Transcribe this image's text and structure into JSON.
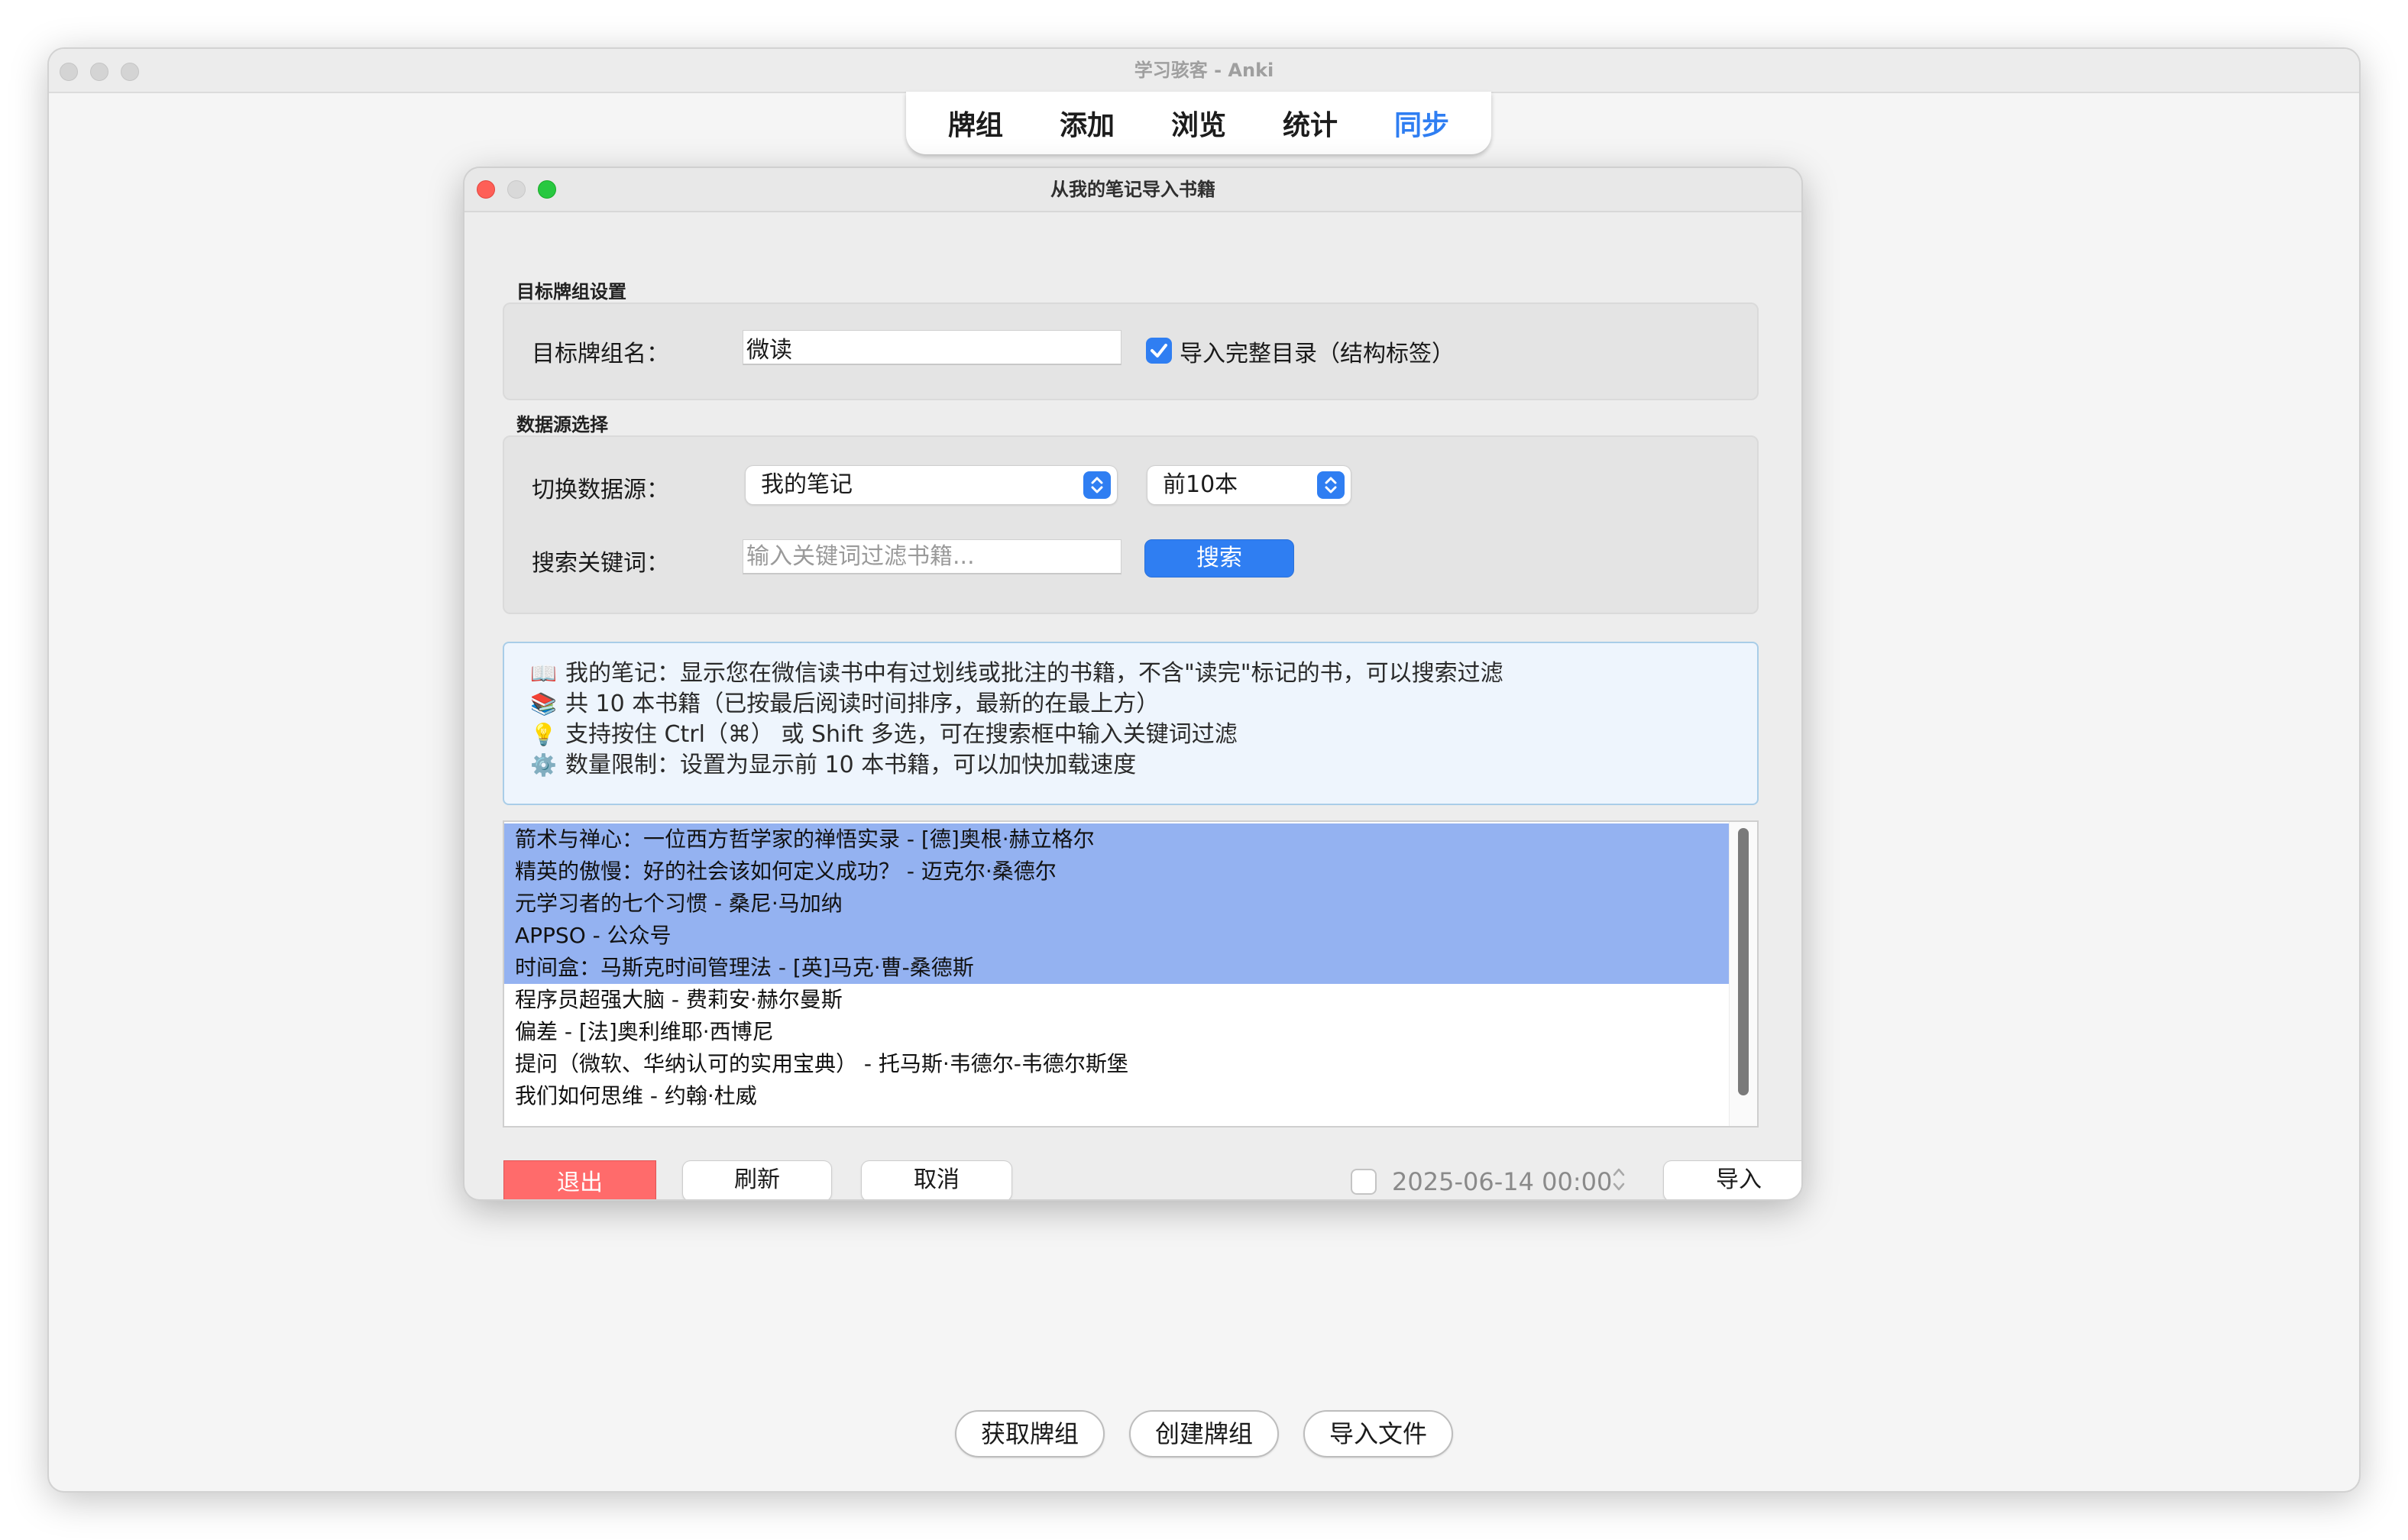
{
  "window": {
    "title": "学习骇客 - Anki"
  },
  "toolbar": {
    "items": [
      {
        "label": "牌组",
        "active": false
      },
      {
        "label": "添加",
        "active": false
      },
      {
        "label": "浏览",
        "active": false
      },
      {
        "label": "统计",
        "active": false
      },
      {
        "label": "同步",
        "active": true
      }
    ],
    "active_color": "#2f7ef2"
  },
  "bottom_buttons": {
    "get_decks": "获取牌组",
    "create_deck": "创建牌组",
    "import_file": "导入文件"
  },
  "dialog": {
    "title": "从我的笔记导入书籍",
    "target_section": {
      "title": "目标牌组设置",
      "deck_name_label": "目标牌组名：",
      "deck_name_value": "微读",
      "import_toc_label": "导入完整目录（结构标签）",
      "import_toc_checked": true
    },
    "source_section": {
      "title": "数据源选择",
      "switch_label": "切换数据源：",
      "source_selected": "我的笔记",
      "limit_selected": "前10本",
      "search_label": "搜索关键词：",
      "search_placeholder": "输入关键词过滤书籍...",
      "search_button": "搜索"
    },
    "info": [
      {
        "icon": "open-book-icon",
        "glyph": "📖",
        "text": "我的笔记：显示您在微信读书中有过划线或批注的书籍，不含\"读完\"标记的书，可以搜索过滤"
      },
      {
        "icon": "books-icon",
        "glyph": "📚",
        "text": "共 10 本书籍（已按最后阅读时间排序，最新的在最上方）"
      },
      {
        "icon": "lightbulb-icon",
        "glyph": "💡",
        "text": "支持按住 Ctrl（⌘） 或 Shift 多选，可在搜索框中输入关键词过滤"
      },
      {
        "icon": "gear-icon",
        "glyph": "⚙️",
        "text": "数量限制：设置为显示前 10 本书籍，可以加快加载速度"
      }
    ],
    "books": [
      {
        "title": "箭术与禅心：一位西方哲学家的禅悟实录 - [德]奥根·赫立格尔",
        "selected": true
      },
      {
        "title": "精英的傲慢：好的社会该如何定义成功？ - 迈克尔·桑德尔",
        "selected": true
      },
      {
        "title": "元学习者的七个习惯 - 桑尼·马加纳",
        "selected": true
      },
      {
        "title": "APPSO - 公众号",
        "selected": true
      },
      {
        "title": "时间盒：马斯克时间管理法 - [英]马克·曹-桑德斯",
        "selected": true
      },
      {
        "title": "程序员超强大脑 - 费莉安·赫尔曼斯",
        "selected": false
      },
      {
        "title": "偏差 - [法]奥利维耶·西博尼",
        "selected": false
      },
      {
        "title": "提问（微软、华纳认可的实用宝典） - 托马斯·韦德尔-韦德尔斯堡",
        "selected": false
      },
      {
        "title": "我们如何思维 - 约翰·杜威",
        "selected": false
      }
    ],
    "buttons": {
      "exit": "退出",
      "refresh": "刷新",
      "cancel": "取消",
      "import": "导入"
    },
    "date_filter": {
      "checked": false,
      "value": "2025-06-14 00:00"
    },
    "selection_color": "#94b2f1",
    "danger_color": "#ff6b6b"
  }
}
